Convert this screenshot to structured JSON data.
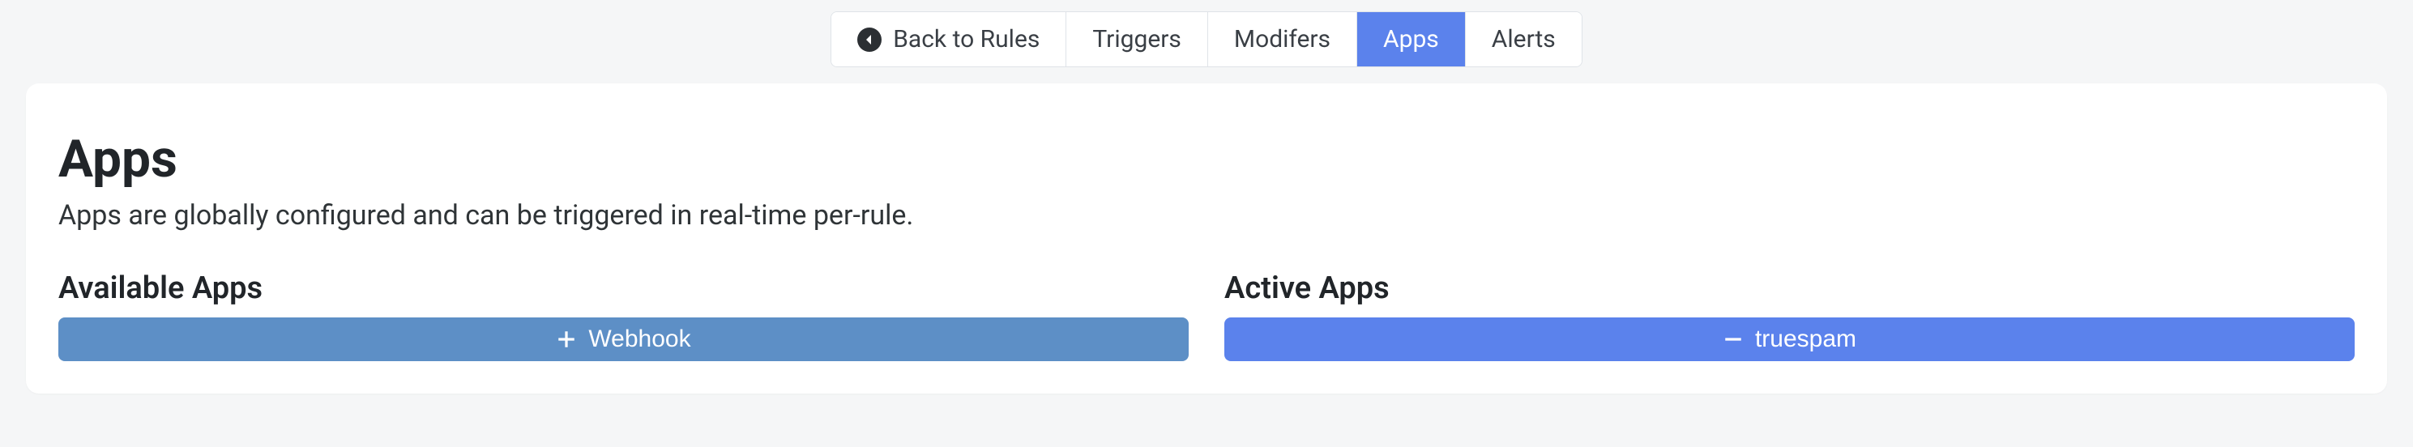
{
  "tabs": {
    "back": "Back to Rules",
    "triggers": "Triggers",
    "modifiers": "Modifers",
    "apps": "Apps",
    "alerts": "Alerts",
    "active": "apps"
  },
  "page": {
    "title": "Apps",
    "subtitle": "Apps are globally configured and can be triggered in real-time per-rule."
  },
  "available": {
    "heading": "Available Apps",
    "items": [
      {
        "label": "Webhook"
      }
    ]
  },
  "active_apps": {
    "heading": "Active Apps",
    "items": [
      {
        "label": "truespam"
      }
    ]
  }
}
